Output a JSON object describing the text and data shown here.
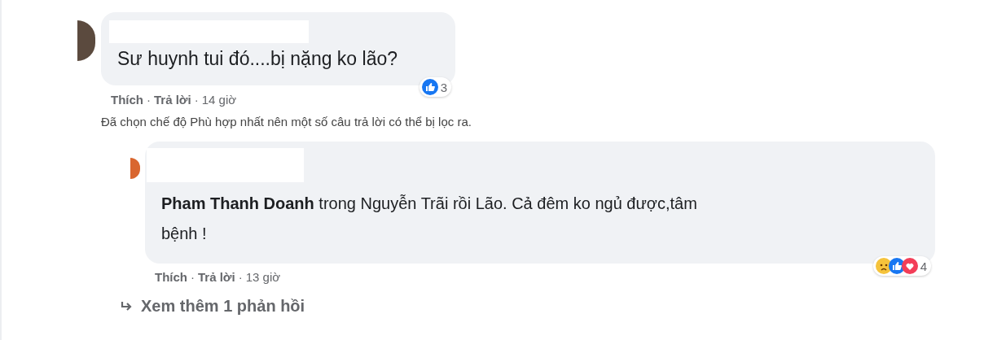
{
  "comment": {
    "text": "Sư huynh tui đó....bị nặng ko lão?",
    "reaction_count": "3",
    "actions": [
      "Thích",
      "Trả lời"
    ],
    "separator": "·",
    "time": "14 giờ"
  },
  "filter_notice": "Đã chọn chế độ Phù hợp nhất nên một số câu trả lời có thể bị lọc ra.",
  "reply": {
    "mention": "Pham Thanh Doanh",
    "text": " trong Nguyễn Trãi rồi Lão. Cả đêm ko ngủ được,tâm bệnh !",
    "reaction_count": "4",
    "actions": [
      "Thích",
      "Trả lời"
    ],
    "separator": "·",
    "time": "13 giờ"
  },
  "more_replies": "Xem thêm 1 phản hồi"
}
